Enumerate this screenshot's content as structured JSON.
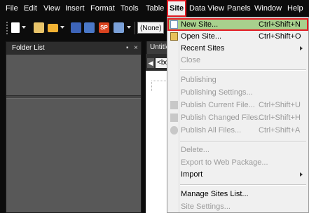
{
  "menubar": {
    "items": [
      "File",
      "Edit",
      "View",
      "Insert",
      "Format",
      "Tools",
      "Table",
      "Site",
      "Data View",
      "Panels",
      "Window",
      "Help"
    ]
  },
  "toolbar": {
    "style_value": "(None)",
    "icons": [
      "new-page-icon",
      "open-icon",
      "folder-icon",
      "save-icon",
      "save-all-icon",
      "sharepoint-icon",
      "preview-icon"
    ]
  },
  "folder_panel": {
    "title": "Folder List",
    "pin": "▪",
    "close": "×",
    "splitter": "....."
  },
  "document": {
    "tab": "Untitle",
    "crumb_arrow": "◀",
    "crumb_tag": "<bo"
  },
  "site_menu": {
    "items": [
      {
        "label": "New Site...",
        "shortcut": "Ctrl+Shift+N",
        "enabled": true,
        "highlight": true,
        "icon": "new-site-icon"
      },
      {
        "label": "Open Site...",
        "shortcut": "Ctrl+Shift+O",
        "enabled": true,
        "icon": "open-site-icon"
      },
      {
        "label": "Recent Sites",
        "shortcut": "",
        "enabled": true,
        "submenu": true
      },
      {
        "label": "Close",
        "shortcut": "",
        "enabled": false
      },
      {
        "label": "Publishing",
        "shortcut": "",
        "enabled": false
      },
      {
        "label": "Publishing Settings...",
        "shortcut": "",
        "enabled": false
      },
      {
        "label": "Publish Current File...",
        "shortcut": "Ctrl+Shift+U",
        "enabled": false,
        "icon": "publish-current-icon"
      },
      {
        "label": "Publish Changed Files...",
        "shortcut": "Ctrl+Shift+H",
        "enabled": false,
        "icon": "publish-changed-icon"
      },
      {
        "label": "Publish All Files...",
        "shortcut": "Ctrl+Shift+A",
        "enabled": false,
        "icon": "publish-all-icon"
      },
      {
        "label": "Delete...",
        "shortcut": "",
        "enabled": false
      },
      {
        "label": "Export to Web Package...",
        "shortcut": "",
        "enabled": false
      },
      {
        "label": "Import",
        "shortcut": "",
        "enabled": true,
        "submenu": true
      },
      {
        "label": "Manage Sites List...",
        "shortcut": "",
        "enabled": true
      },
      {
        "label": "Site Settings...",
        "shortcut": "",
        "enabled": false
      }
    ]
  },
  "colors": {
    "highlight": "#a8d08d",
    "annotation_red": "#e31b23",
    "menu_bg": "#f0f0f0",
    "app_bg": "#0c0c0c"
  }
}
